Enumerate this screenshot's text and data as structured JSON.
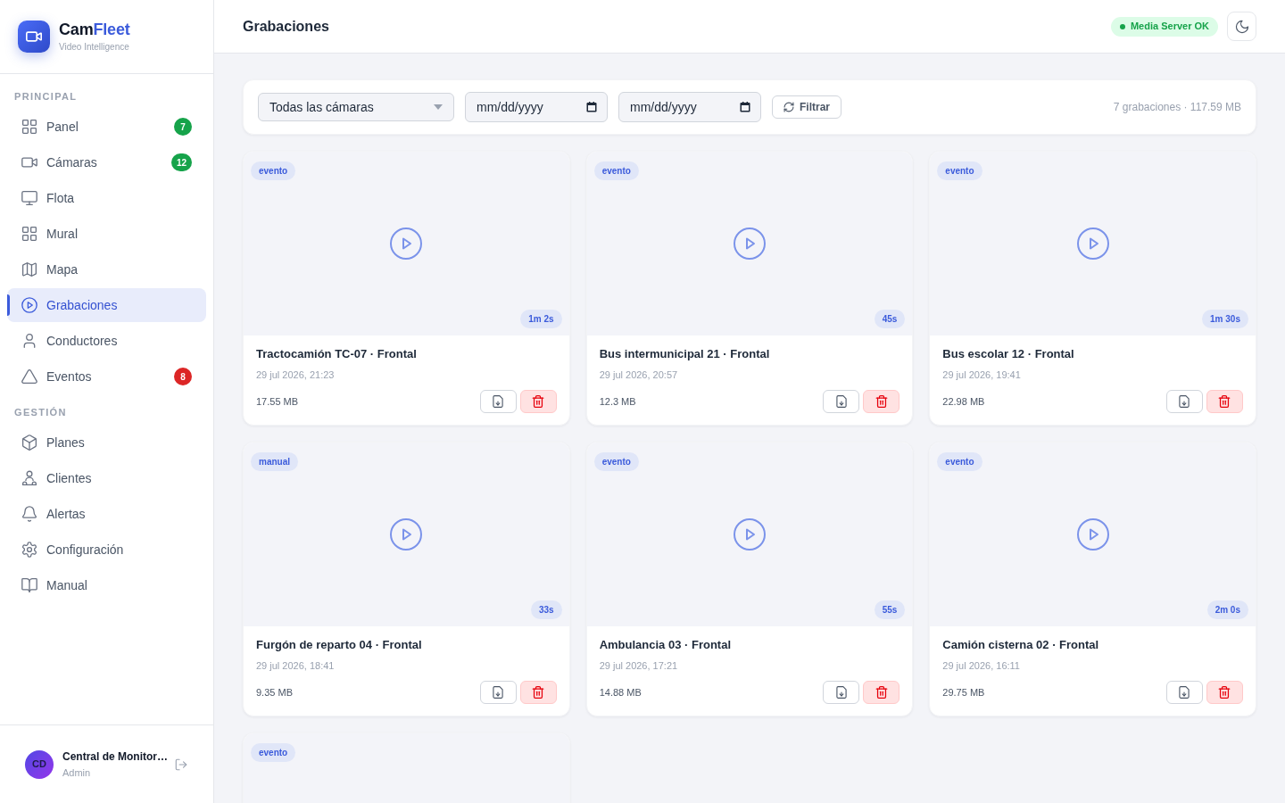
{
  "brand": {
    "name": "Cam",
    "name_accent": "Fleet",
    "tagline": "Video Intelligence"
  },
  "sidebar": {
    "sections": [
      {
        "label": "PRINCIPAL",
        "items": [
          {
            "label": "Panel",
            "selected": false,
            "badge": {
              "text": "7",
              "color": "#16a34a"
            }
          },
          {
            "label": "Cámaras",
            "selected": false,
            "badge": {
              "text": "12",
              "color": "#16a34a"
            }
          },
          {
            "label": "Flota",
            "selected": false
          },
          {
            "label": "Mural",
            "selected": false
          },
          {
            "label": "Mapa",
            "selected": false
          },
          {
            "label": "Grabaciones",
            "selected": true
          },
          {
            "label": "Conductores",
            "selected": false
          },
          {
            "label": "Eventos",
            "selected": false,
            "badge": {
              "text": "8",
              "color": "#dc2626"
            }
          }
        ]
      },
      {
        "label": "GESTIÓN",
        "items": [
          {
            "label": "Planes",
            "selected": false
          },
          {
            "label": "Clientes",
            "selected": false
          },
          {
            "label": "Alertas",
            "selected": false
          },
          {
            "label": "Configuración",
            "selected": false
          },
          {
            "label": "Manual",
            "selected": false
          }
        ]
      }
    ]
  },
  "user": {
    "initials": "CD",
    "name": "Central de Monitor…",
    "role": "Admin"
  },
  "header": {
    "title": "Grabaciones",
    "server_status": "Media Server OK"
  },
  "filters": {
    "camera": {
      "value": "Todas las cámaras"
    },
    "date_from": {
      "placeholder": "mm/dd/yyyy"
    },
    "date_to": {
      "placeholder": "mm/dd/yyyy"
    },
    "filter_button": "Filtrar",
    "summary": "7 grabaciones · 117.59 MB"
  },
  "recordings": [
    {
      "tag": "evento",
      "duration": "1m 2s",
      "title": "Tractocamión TC-07 · Frontal",
      "date": "29 jul 2026, 21:23",
      "size": "17.55 MB"
    },
    {
      "tag": "evento",
      "duration": "45s",
      "title": "Bus intermunicipal 21 · Frontal",
      "date": "29 jul 2026, 20:57",
      "size": "12.3 MB"
    },
    {
      "tag": "evento",
      "duration": "1m 30s",
      "title": "Bus escolar 12 · Frontal",
      "date": "29 jul 2026, 19:41",
      "size": "22.98 MB"
    },
    {
      "tag": "manual",
      "duration": "33s",
      "title": "Furgón de reparto 04 · Frontal",
      "date": "29 jul 2026, 18:41",
      "size": "9.35 MB"
    },
    {
      "tag": "evento",
      "duration": "55s",
      "title": "Ambulancia 03 · Frontal",
      "date": "29 jul 2026, 17:21",
      "size": "14.88 MB"
    },
    {
      "tag": "evento",
      "duration": "2m 0s",
      "title": "Camión cisterna 02 · Frontal",
      "date": "29 jul 2026, 16:11",
      "size": "29.75 MB"
    },
    {
      "tag": "evento"
    }
  ]
}
